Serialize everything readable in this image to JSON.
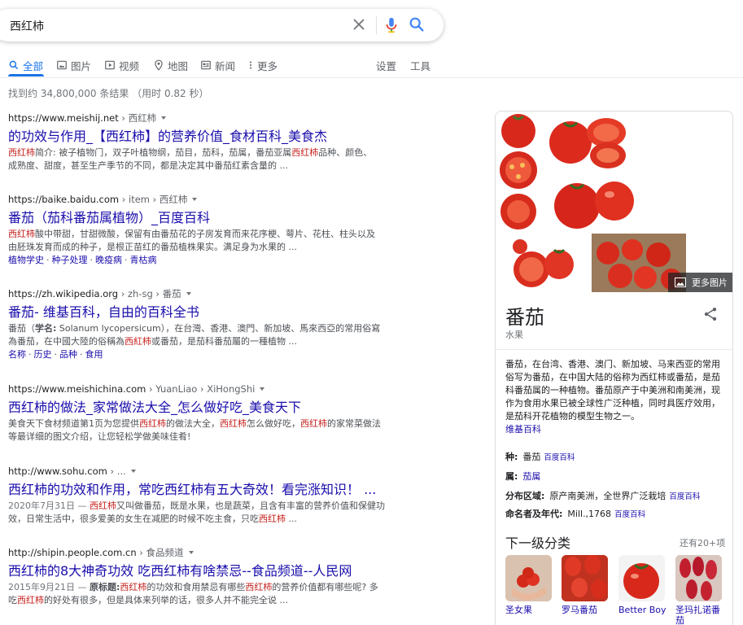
{
  "search": {
    "query": "西红柿"
  },
  "tabs": [
    {
      "label": "全部",
      "icon": "search-icon"
    },
    {
      "label": "图片",
      "icon": "image-icon"
    },
    {
      "label": "视频",
      "icon": "video-icon"
    },
    {
      "label": "地图",
      "icon": "map-pin-icon"
    },
    {
      "label": "新闻",
      "icon": "news-icon"
    },
    {
      "label": "更多",
      "icon": "more-dots-icon"
    }
  ],
  "tools": {
    "settings": "设置",
    "tools": "工具"
  },
  "stats": "找到约 34,800,000 条结果 （用时 0.82 秒）",
  "results": [
    {
      "url": "https://www.meishij.net",
      "crumb": "› 西红柿",
      "title": "的功效与作用_【西红柿】的营养价值_食材百科_美食杰",
      "s1": "西红柿",
      "s2": "简介: 被子植物门，双子叶植物纲，茄目，茄科，茄属，番茄亚属",
      "s3": "西红柿",
      "s4": "品种、颜色、",
      "s5": "成熟度、甜度，甚至生产季节的不同，都是决定其中番茄红素含量的 ..."
    },
    {
      "url": "https://baike.baidu.com",
      "crumb": "› item › 西红柿",
      "title": "番茄（茄科番茄属植物）_百度百科",
      "s1": "西红柿",
      "s2": "酸中带甜，甘甜微酸，保留有由番茄花的子房发育而来花序梗、萼片、花柱、柱头以及",
      "s3": "由胚珠发育而成的种子，是根正苗红的番茄植株果实。满足身为水果的 ...",
      "links": [
        "植物学史",
        "种子处理",
        "晚疫病",
        "青枯病"
      ]
    },
    {
      "url": "https://zh.wikipedia.org",
      "crumb": "› zh-sg › 番茄",
      "title": "番茄- 维基百科，自由的百科全书",
      "s1": "番茄（",
      "s2": "学名:",
      "s3": " Solanum lycopersicum），在台灣、香港、澳門、新加坡、馬來西亞的常用俗寫",
      "s4": "為番茄，在中國大陸的俗稱為",
      "s5": "西紅柿",
      "s6": "或番茄，是茄科番茄屬的一種植物 ...",
      "links": [
        "名称",
        "历史",
        "品种",
        "食用"
      ]
    },
    {
      "url": "https://www.meishichina.com",
      "crumb": "› YuanLiao › XiHongShi",
      "title": "西红柿的做法_家常做法大全_怎么做好吃_美食天下",
      "s1": "美食天下食材频道第1页为您提供",
      "s2": "西红柿",
      "s3": "的做法大全，",
      "s4": "西红柿",
      "s5": "怎么做好吃，",
      "s6": "西红柿",
      "s7": "的家常菜做法",
      "s8": "等最详细的图文介绍，让您轻松学做美味佳肴!"
    },
    {
      "url": "http://www.sohu.com",
      "crumb": "› ...",
      "title": "西红柿的功效和作用，常吃西红柿有五大奇效！看完涨知识！ ...",
      "date": "2020年7月31日 — ",
      "s1": "西红柿",
      "s2": "又叫做番茄，既是水果，也是蔬菜，且含有丰富的营养价值和保健功",
      "s3": "效，日常生活中，很多爱美的女生在减肥的时候不吃主食，只吃",
      "s4": "西红柿",
      "s5": " ..."
    },
    {
      "url": "http://shipin.people.com.cn",
      "crumb": "› 食品频道",
      "title": "西红柿的8大神奇功效 吃西红柿有啥禁忌--食品频道--人民网",
      "date": "2015年9月21日 — ",
      "s1": "原标题:",
      "s2": "西红柿",
      "s3": "的功效和食用禁忌有哪些",
      "s4": "西红柿",
      "s5": "的营养价值都有哪些呢? 多",
      "s6": "吃",
      "s7": "西红柿",
      "s8": "的好处有很多，但是具体来列举的话，很多人并不能完全说 ..."
    }
  ],
  "kp": {
    "more_images": "更多图片",
    "title": "番茄",
    "subtitle": "水果",
    "description": "番茄，在台湾、香港、澳门、新加坡、马来西亚的常用俗写为番茄，在中国大陆的俗称为西红柿或番茄，是茄科番茄属的一种植物。番茄原产于中美洲和南美洲，现作为食用水果已被全球性广泛种植，同时具医疗效用，是茄科开花植物的模型生物之一。",
    "desc_source": "维基百科",
    "facts": [
      {
        "label": "种:",
        "value": "番茄",
        "src": "百度百科"
      },
      {
        "label": "属:",
        "value": "茄属",
        "src": ""
      },
      {
        "label": "分布区域:",
        "value": "原产南美洲，全世界广泛栽培",
        "src": "百度百科"
      },
      {
        "label": "命名者及年代:",
        "value": "Mill.,1768",
        "src": "百度百科"
      }
    ],
    "subcat_title": "下一级分类",
    "subcat_more": "还有20+项",
    "subcats": [
      {
        "label": "圣女果"
      },
      {
        "label": "罗马番茄"
      },
      {
        "label": "Better Boy"
      },
      {
        "label": "圣玛扎诺番茄"
      }
    ]
  },
  "colors": {
    "link": "#1a0dab",
    "accent": "#1a73e8",
    "highlight": "#c5221f",
    "tomato": "#d93a2b"
  }
}
